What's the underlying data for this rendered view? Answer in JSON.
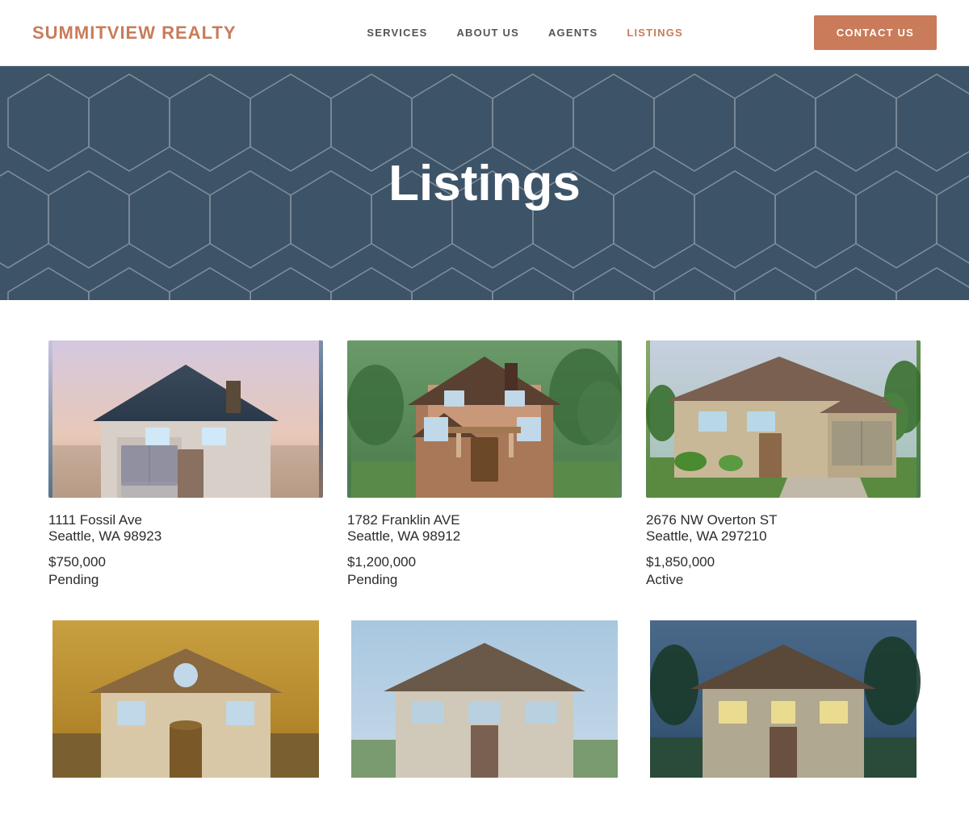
{
  "brand": {
    "name_part1": "SUMMITVIEW",
    "name_part2": "REALTY"
  },
  "nav": {
    "links": [
      {
        "label": "SERVICES",
        "active": false
      },
      {
        "label": "ABOUT US",
        "active": false
      },
      {
        "label": "AGENTS",
        "active": false
      },
      {
        "label": "LISTINGS",
        "active": true
      }
    ],
    "contact_label": "CONTACT US"
  },
  "hero": {
    "title": "Listings"
  },
  "listings": [
    {
      "address_line1": "1111 Fossil Ave",
      "address_line2": "Seattle, WA 98923",
      "price": "$750,000",
      "status": "Pending",
      "image_color1": "#b0afc8",
      "image_color2": "#5a6e8a",
      "image_emoji": "🏠"
    },
    {
      "address_line1": "1782 Franklin AVE",
      "address_line2": "Seattle, WA 98912",
      "price": "$1,200,000",
      "status": "Pending",
      "image_color1": "#7a9e7a",
      "image_color2": "#4a7a4a",
      "image_emoji": "🏡"
    },
    {
      "address_line1": "2676 NW Overton ST",
      "address_line2": "Seattle, WA 297210",
      "price": "$1,850,000",
      "status": "Active",
      "image_color1": "#8aaa6a",
      "image_color2": "#5a7a4a",
      "image_emoji": "🏘"
    },
    {
      "address_line1": "",
      "address_line2": "",
      "price": "",
      "status": "",
      "image_color1": "#c8a870",
      "image_color2": "#8a6a40",
      "image_emoji": "🏠"
    },
    {
      "address_line1": "",
      "address_line2": "",
      "price": "",
      "status": "",
      "image_color1": "#aac8d0",
      "image_color2": "#6a9aaa",
      "image_emoji": "🏡"
    },
    {
      "address_line1": "",
      "address_line2": "",
      "price": "",
      "status": "",
      "image_color1": "#7a9ab0",
      "image_color2": "#4a6a80",
      "image_emoji": "🏘"
    }
  ]
}
